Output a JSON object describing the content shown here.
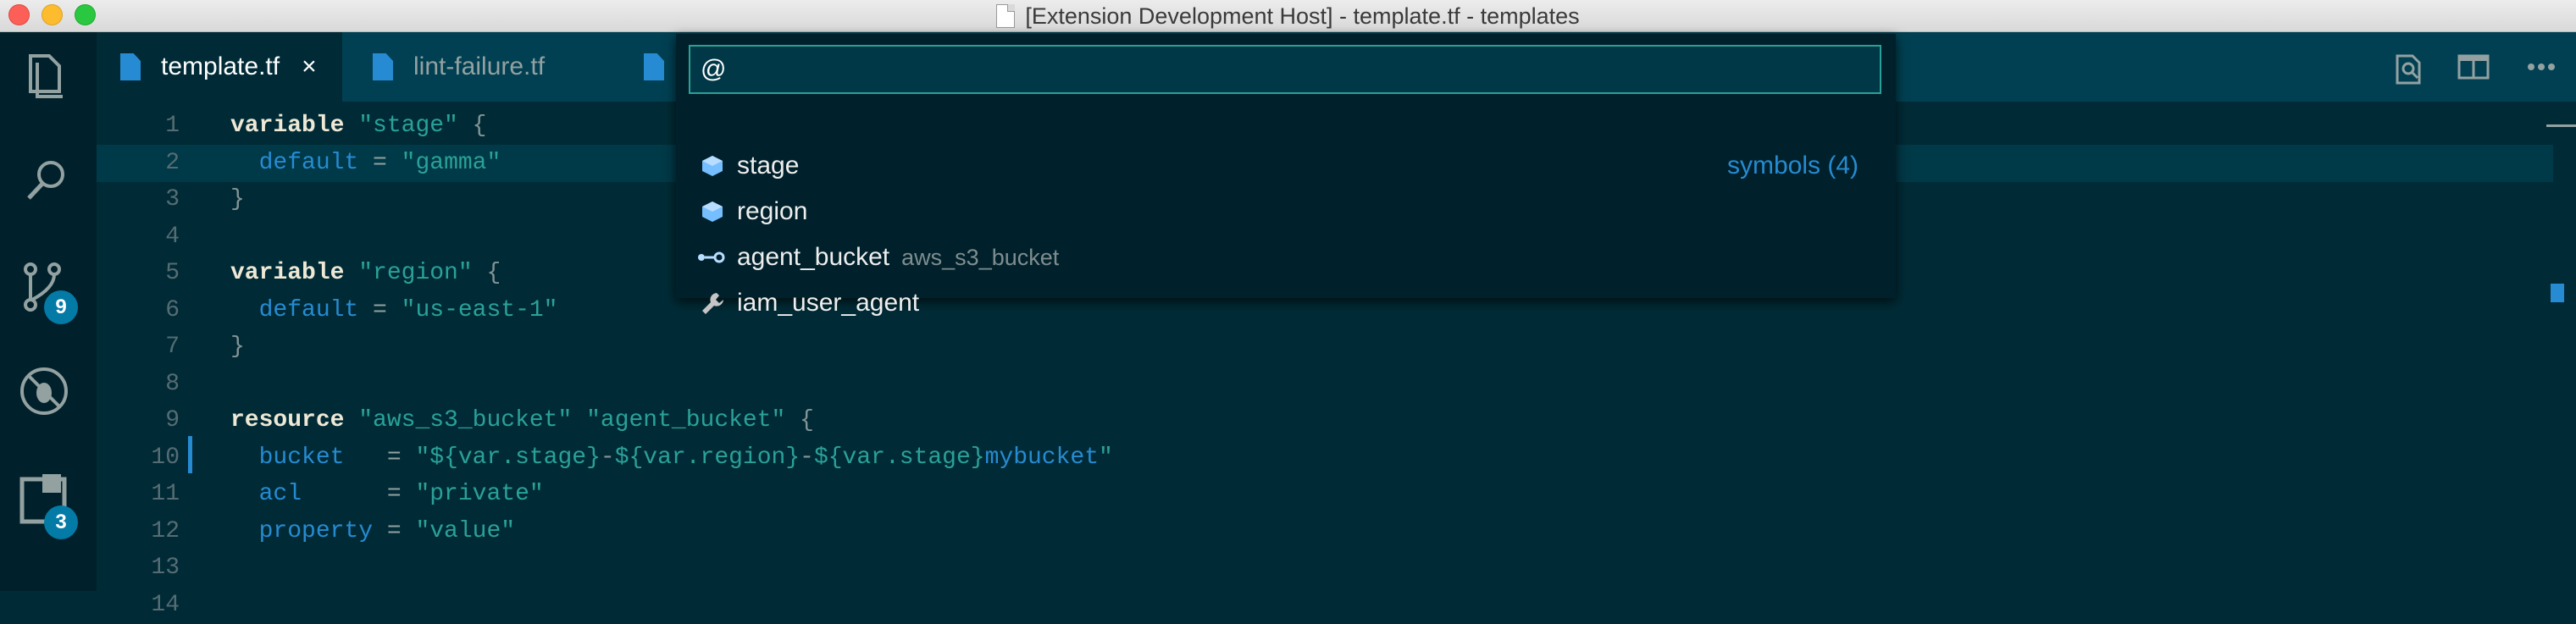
{
  "window": {
    "title": "[Extension Development Host] - template.tf - templates"
  },
  "activity_bar": {
    "items": [
      {
        "name": "explorer-icon"
      },
      {
        "name": "search-icon"
      },
      {
        "name": "source-control-icon",
        "badge": "9"
      },
      {
        "name": "debug-icon"
      },
      {
        "name": "extensions-icon",
        "badge": "3"
      }
    ]
  },
  "tabs": [
    {
      "label": "template.tf",
      "active": true,
      "close": "×"
    },
    {
      "label": "lint-failure.tf",
      "active": false
    }
  ],
  "editor": {
    "lines": [
      {
        "n": "1",
        "tokens": [
          [
            "kw",
            "variable"
          ],
          [
            "plain",
            " "
          ],
          [
            "str",
            "\"stage\""
          ],
          [
            "plain",
            " "
          ],
          [
            "punc",
            "{"
          ]
        ]
      },
      {
        "n": "2",
        "tokens": [
          [
            "plain",
            "  "
          ],
          [
            "prop",
            "default"
          ],
          [
            "plain",
            " = "
          ],
          [
            "str",
            "\"gamma\""
          ]
        ]
      },
      {
        "n": "3",
        "tokens": [
          [
            "punc",
            "}"
          ]
        ]
      },
      {
        "n": "4",
        "tokens": []
      },
      {
        "n": "5",
        "tokens": [
          [
            "kw",
            "variable"
          ],
          [
            "plain",
            " "
          ],
          [
            "str",
            "\"region\""
          ],
          [
            "plain",
            " "
          ],
          [
            "punc",
            "{"
          ]
        ]
      },
      {
        "n": "6",
        "tokens": [
          [
            "plain",
            "  "
          ],
          [
            "prop",
            "default"
          ],
          [
            "plain",
            " = "
          ],
          [
            "str",
            "\"us-east-1\""
          ]
        ]
      },
      {
        "n": "7",
        "tokens": [
          [
            "punc",
            "}"
          ]
        ]
      },
      {
        "n": "8",
        "tokens": []
      },
      {
        "n": "9",
        "tokens": [
          [
            "kw",
            "resource"
          ],
          [
            "plain",
            " "
          ],
          [
            "str",
            "\"aws_s3_bucket\""
          ],
          [
            "plain",
            " "
          ],
          [
            "str",
            "\"agent_bucket\""
          ],
          [
            "plain",
            " "
          ],
          [
            "punc",
            "{"
          ]
        ]
      },
      {
        "n": "10",
        "tokens": [
          [
            "plain",
            "  "
          ],
          [
            "prop",
            "bucket"
          ],
          [
            "plain",
            "   = "
          ],
          [
            "str",
            "\"${var.stage}"
          ],
          [
            "punc",
            "-"
          ],
          [
            "str",
            "${var.region}"
          ],
          [
            "punc",
            "-"
          ],
          [
            "str",
            "${var.stage}"
          ],
          [
            "prop",
            "mybucket"
          ],
          [
            "str",
            "\""
          ]
        ]
      },
      {
        "n": "11",
        "tokens": [
          [
            "plain",
            "  "
          ],
          [
            "prop",
            "acl"
          ],
          [
            "plain",
            "      = "
          ],
          [
            "str",
            "\"private\""
          ]
        ]
      },
      {
        "n": "12",
        "tokens": [
          [
            "plain",
            "  "
          ],
          [
            "prop",
            "property"
          ],
          [
            "plain",
            " = "
          ],
          [
            "str",
            "\"value\""
          ]
        ]
      },
      {
        "n": "13",
        "tokens": []
      },
      {
        "n": "14",
        "tokens": []
      }
    ]
  },
  "quick_open": {
    "value": "@",
    "meta": "symbols (4)",
    "items": [
      {
        "label": "stage",
        "detail": "",
        "icon": "variable-icon"
      },
      {
        "label": "region",
        "detail": "",
        "icon": "variable-icon"
      },
      {
        "label": "agent_bucket",
        "detail": "aws_s3_bucket",
        "icon": "resource-icon"
      },
      {
        "label": "iam_user_agent",
        "detail": "",
        "icon": "wrench-icon"
      }
    ]
  },
  "colors": {
    "background": "#002b36",
    "activity_bar": "#00212b",
    "tab_bar": "#004052",
    "accent": "#268bd2",
    "string": "#2aa198",
    "badge": "#047aa6"
  }
}
